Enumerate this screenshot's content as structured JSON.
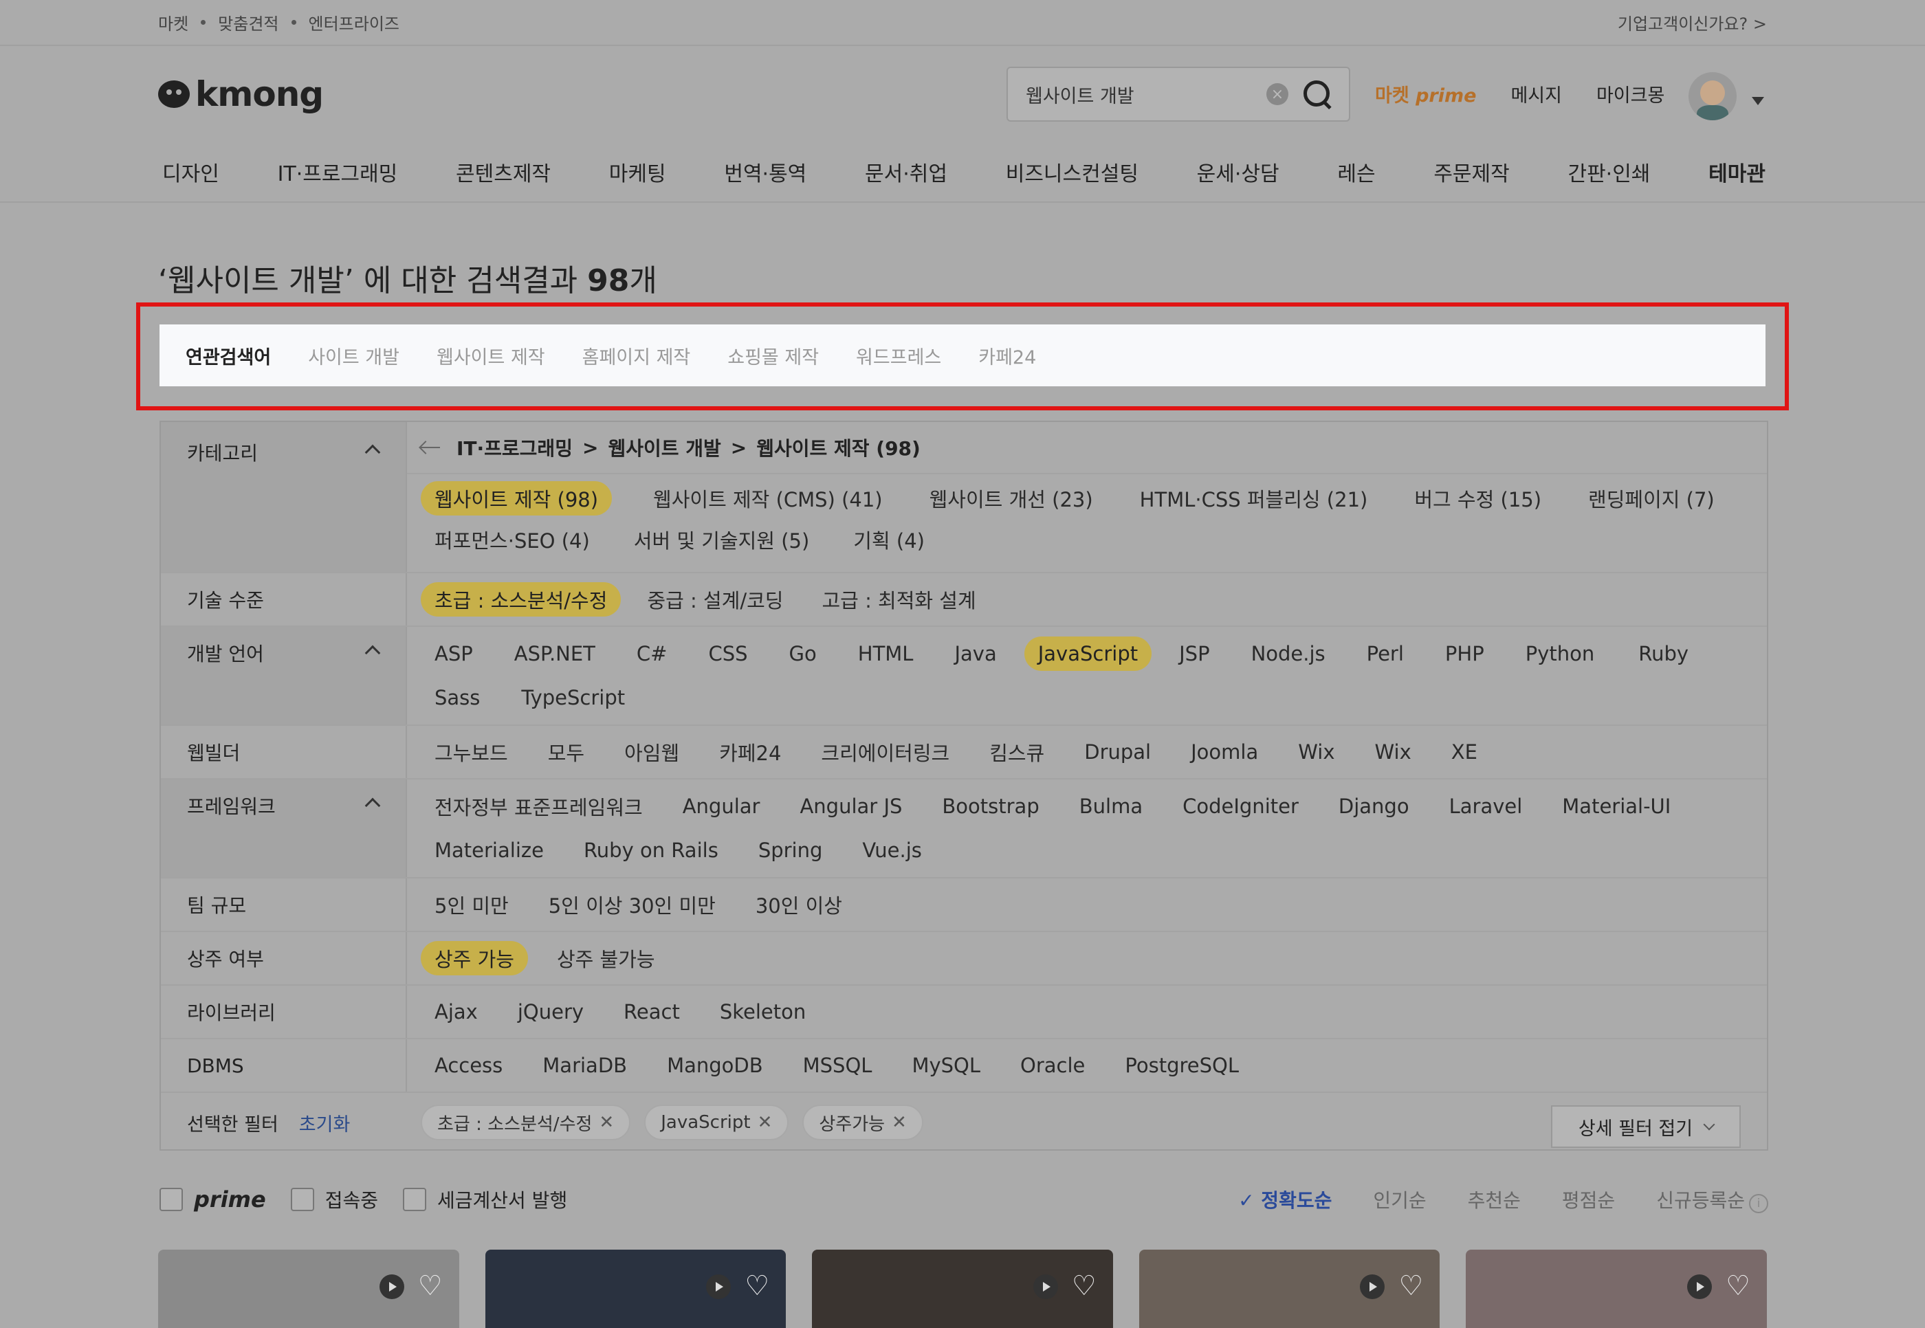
{
  "topbar": {
    "crumbs": [
      "마켓",
      "맞춤견적",
      "엔터프라이즈"
    ],
    "enterprise_link": "기업고객이신가요? >"
  },
  "header": {
    "logo_text": "kmong",
    "search_value": "웹사이트 개발",
    "clear_label": "×",
    "prime_market_a": "마켓",
    "prime_market_b": "prime",
    "messages": "메시지",
    "mykmong": "마이크몽"
  },
  "nav": [
    "디자인",
    "IT·프로그래밍",
    "콘텐츠제작",
    "마케팅",
    "번역·통역",
    "문서·취업",
    "비즈니스컨설팅",
    "운세·상담",
    "레슨",
    "주문제작",
    "간판·인쇄",
    "테마관"
  ],
  "results": {
    "query": "‘웹사이트 개발’",
    "middle": " 에 대한 검색결과 ",
    "count": "98",
    "unit": "개"
  },
  "related": {
    "label": "연관검색어",
    "terms": [
      "사이트 개발",
      "웹사이트 제작",
      "홈페이지 제작",
      "쇼핑몰 제작",
      "워드프레스",
      "카페24"
    ]
  },
  "filters": {
    "category_label": "카테고리",
    "category_path": [
      "IT·프로그래밍",
      ">",
      "웹사이트 개발",
      ">",
      "웹사이트 제작 (98)"
    ],
    "categories": [
      "웹사이트 제작 (98)",
      "웹사이트 제작 (CMS) (41)",
      "웹사이트 개선 (23)",
      "HTML·CSS 퍼블리싱 (21)",
      "버그 수정 (15)",
      "랜딩페이지 (7)",
      "퍼포먼스·SEO (4)",
      "서버 및 기술지원 (5)",
      "기획 (4)"
    ],
    "skill_label": "기술 수준",
    "skills": [
      "초급 : 소스분석/수정",
      "중급 : 설계/코딩",
      "고급 : 최적화 설계"
    ],
    "lang_label": "개발 언어",
    "langs": [
      "ASP",
      "ASP.NET",
      "C#",
      "CSS",
      "Go",
      "HTML",
      "Java",
      "JavaScript",
      "JSP",
      "Node.js",
      "Perl",
      "PHP",
      "Python",
      "Ruby",
      "Sass",
      "TypeScript"
    ],
    "builder_label": "웹빌더",
    "builders": [
      "그누보드",
      "모두",
      "아임웹",
      "카페24",
      "크리에이터링크",
      "킴스큐",
      "Drupal",
      "Joomla",
      "Wix",
      "Wix",
      "XE"
    ],
    "framework_label": "프레임워크",
    "frameworks": [
      "전자정부 표준프레임워크",
      "Angular",
      "Angular JS",
      "Bootstrap",
      "Bulma",
      "CodeIgniter",
      "Django",
      "Laravel",
      "Material-UI",
      "Materialize",
      "Ruby on Rails",
      "Spring",
      "Vue.js"
    ],
    "team_label": "팀 규모",
    "teams": [
      "5인 미만",
      "5인 이상 30인 미만",
      "30인 이상"
    ],
    "resident_label": "상주 여부",
    "residents": [
      "상주 가능",
      "상주 불가능"
    ],
    "library_label": "라이브러리",
    "libraries": [
      "Ajax",
      "jQuery",
      "React",
      "Skeleton"
    ],
    "dbms_label": "DBMS",
    "dbms": [
      "Access",
      "MariaDB",
      "MangoDB",
      "MSSQL",
      "MySQL",
      "Oracle",
      "PostgreSQL"
    ],
    "selected_label": "선택한 필터",
    "reset_label": "초기화",
    "selected_tags": [
      "초급 : 소스분석/수정",
      "JavaScript",
      "상주가능"
    ],
    "fold_label": "상세 필터 접기"
  },
  "sortbar": {
    "prime": "prime",
    "online": "접속중",
    "tax": "세금계산서 발행",
    "sorts": [
      "✓ 정확도순",
      "인기순",
      "추천순",
      "평점순",
      "신규등록순"
    ],
    "info": "i"
  },
  "cards": [
    {
      "color": "#8a8a8a",
      "heart": "♡"
    },
    {
      "color": "#2a3240",
      "heart": "♡"
    },
    {
      "color": "#3a3430",
      "heart": "♡"
    },
    {
      "color": "#6a6058",
      "heart": "♡"
    },
    {
      "color": "#7a6a6a",
      "heart": "♡"
    }
  ]
}
